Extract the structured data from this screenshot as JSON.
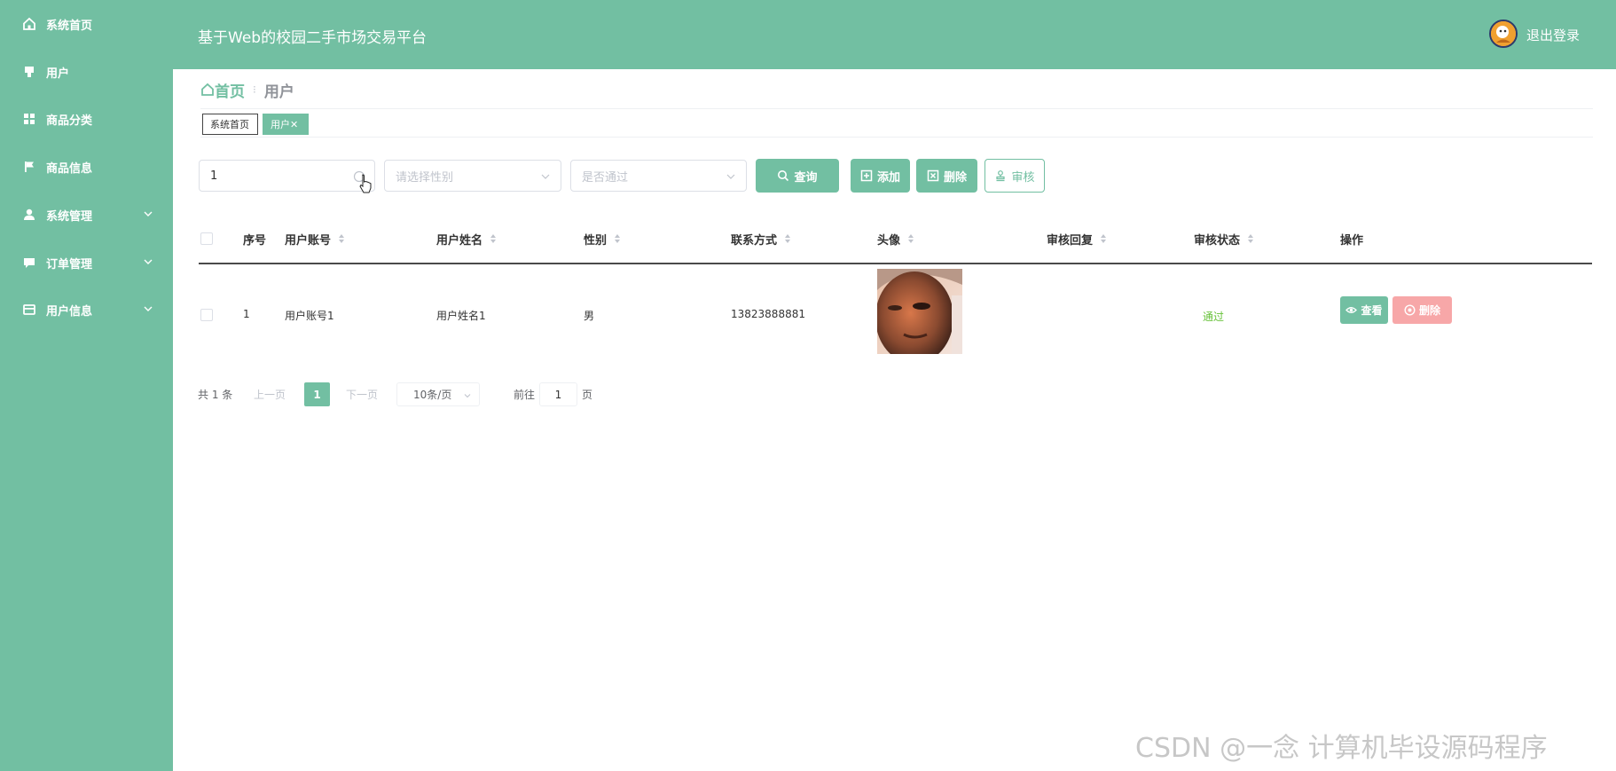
{
  "sidebar": {
    "items": [
      {
        "label": "系统首页",
        "icon": "home-icon"
      },
      {
        "label": "用户",
        "icon": "user-icon"
      },
      {
        "label": "商品分类",
        "icon": "grid-icon"
      },
      {
        "label": "商品信息",
        "icon": "flag-icon"
      },
      {
        "label": "系统管理",
        "icon": "person-icon"
      },
      {
        "label": "订单管理",
        "icon": "chat-icon"
      },
      {
        "label": "用户信息",
        "icon": "card-icon"
      }
    ]
  },
  "header": {
    "title": "基于Web的校园二手市场交易平台",
    "logout": "退出登录"
  },
  "breadcrumb": {
    "home": "首页",
    "current": "用户"
  },
  "tags": {
    "home": "系统首页",
    "current": "用户✕"
  },
  "filters": {
    "account_value": "1",
    "gender_placeholder": "请选择性别",
    "approved_placeholder": "是否通过"
  },
  "buttons": {
    "search": "查询",
    "add": "添加",
    "delete": "删除",
    "audit": "审核"
  },
  "table": {
    "headers": [
      "序号",
      "用户账号",
      "用户姓名",
      "性别",
      "联系方式",
      "头像",
      "审核回复",
      "审核状态",
      "操作"
    ],
    "rows": [
      {
        "index": "1",
        "account": "用户账号1",
        "name": "用户姓名1",
        "gender": "男",
        "phone": "13823888881",
        "reply": "",
        "status": "通过",
        "view": "查看",
        "delete": "删除"
      }
    ]
  },
  "pagination": {
    "total": "共 1 条",
    "prev": "上一页",
    "page": "1",
    "next": "下一页",
    "size": "10条/页",
    "goto": "前往",
    "goto_value": "1",
    "page_unit": "页"
  },
  "watermark": "CSDN @一念 计算机毕设源码程序",
  "colors": {
    "primary": "#72bfa2",
    "danger_light": "#f7a7a8",
    "success": "#67c23a"
  }
}
